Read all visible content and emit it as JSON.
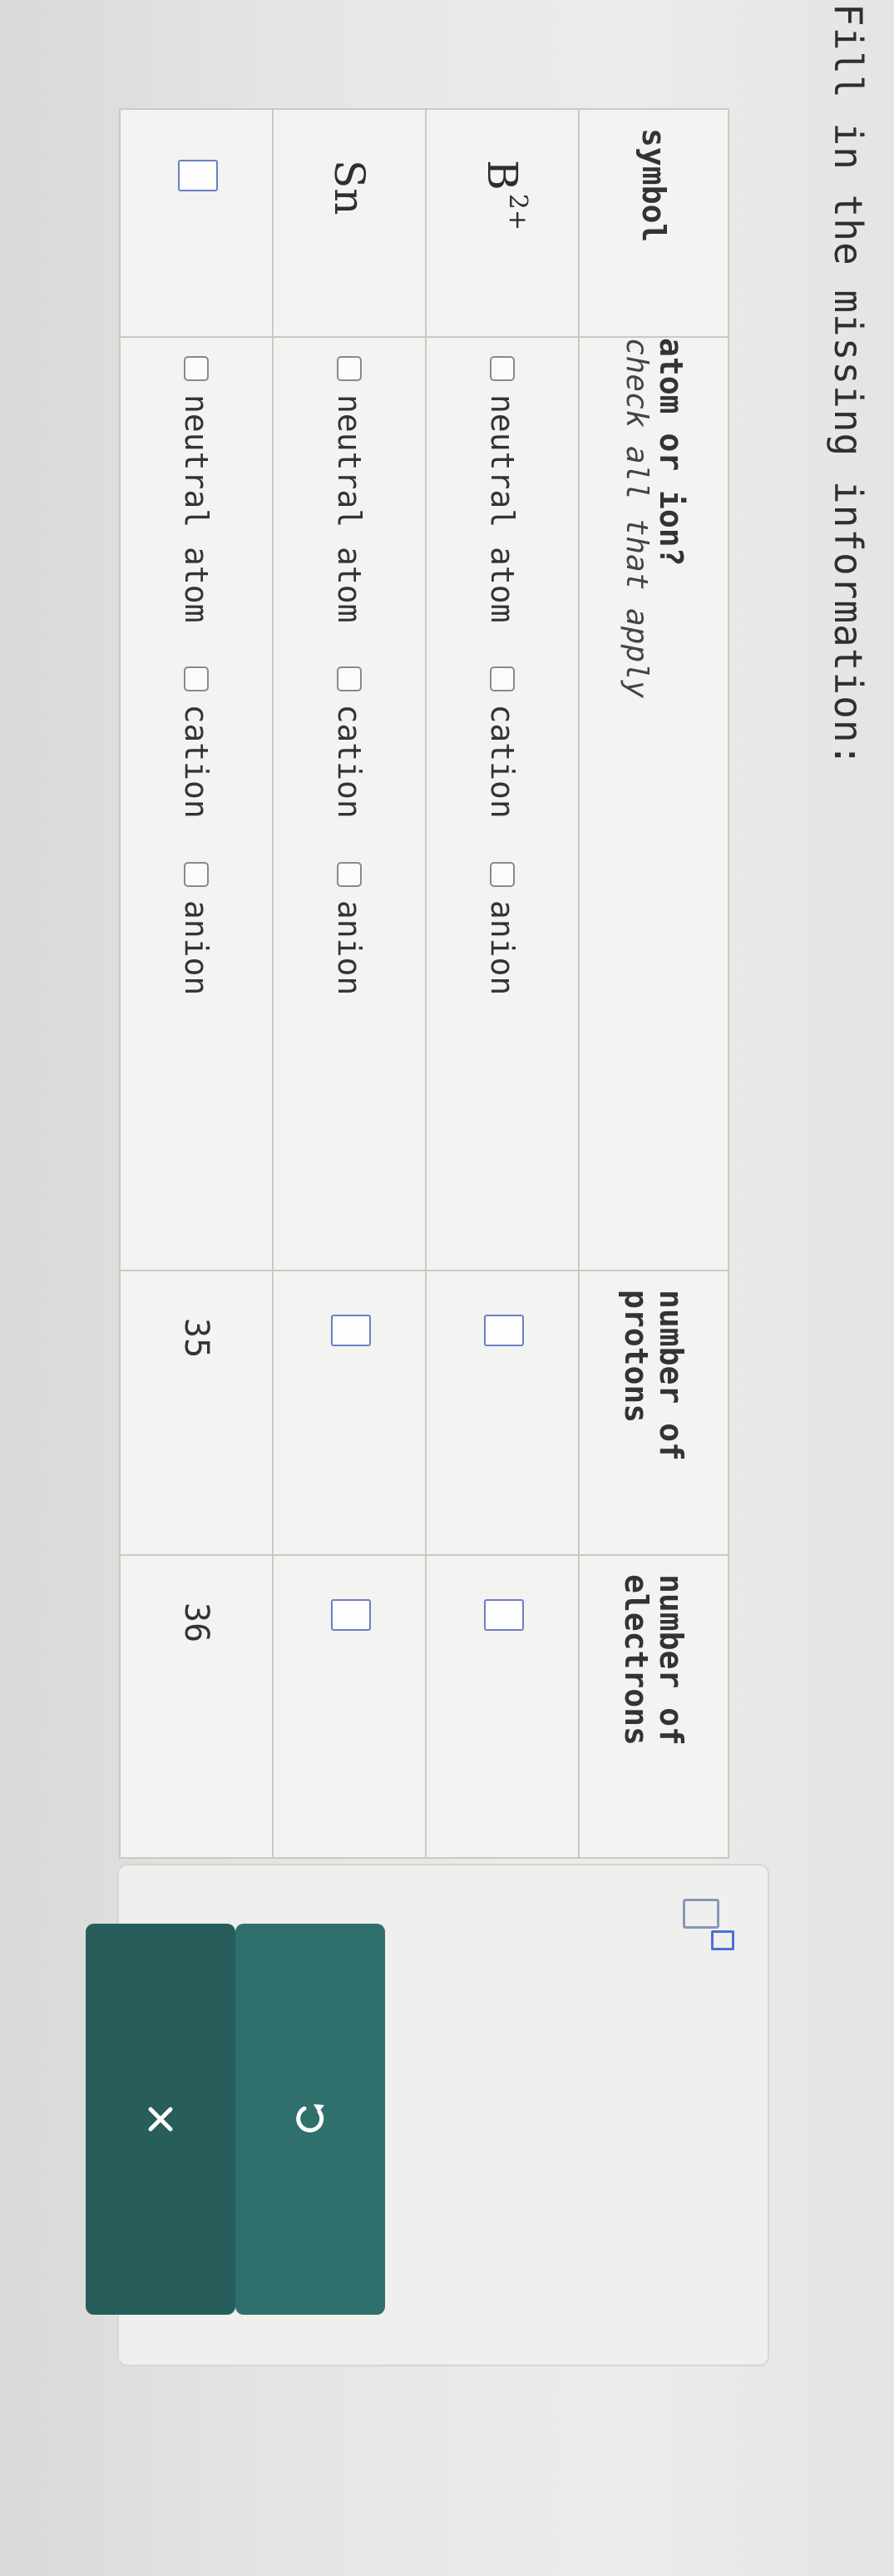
{
  "prompt": "Fill in the missing information:",
  "table": {
    "headers": {
      "symbol": "symbol",
      "type_title": "atom or ion?",
      "type_subtitle": "check all that apply",
      "protons_line1": "number of",
      "protons_line2": "protons",
      "electrons_line1": "number of",
      "electrons_line2": "electrons"
    },
    "rows": [
      {
        "symbol": "B",
        "charge": "2+",
        "options": [
          "neutral atom",
          "cation",
          "anion"
        ],
        "protons": "",
        "electrons": ""
      },
      {
        "symbol": "Sn",
        "charge": "",
        "options": [
          "neutral atom",
          "cation",
          "anion"
        ],
        "protons": "",
        "electrons": ""
      },
      {
        "symbol": "",
        "charge": "",
        "options": [
          "neutral atom",
          "cation",
          "anion"
        ],
        "protons": "35",
        "electrons": "36"
      }
    ]
  },
  "tools": {
    "superscript_icon": "superscript-icon",
    "undo_icon": "undo-icon",
    "clear_icon": "close-icon"
  },
  "colors": {
    "button_teal": "#2f6f6c",
    "input_border": "#6a7fc4",
    "text": "#333333"
  }
}
